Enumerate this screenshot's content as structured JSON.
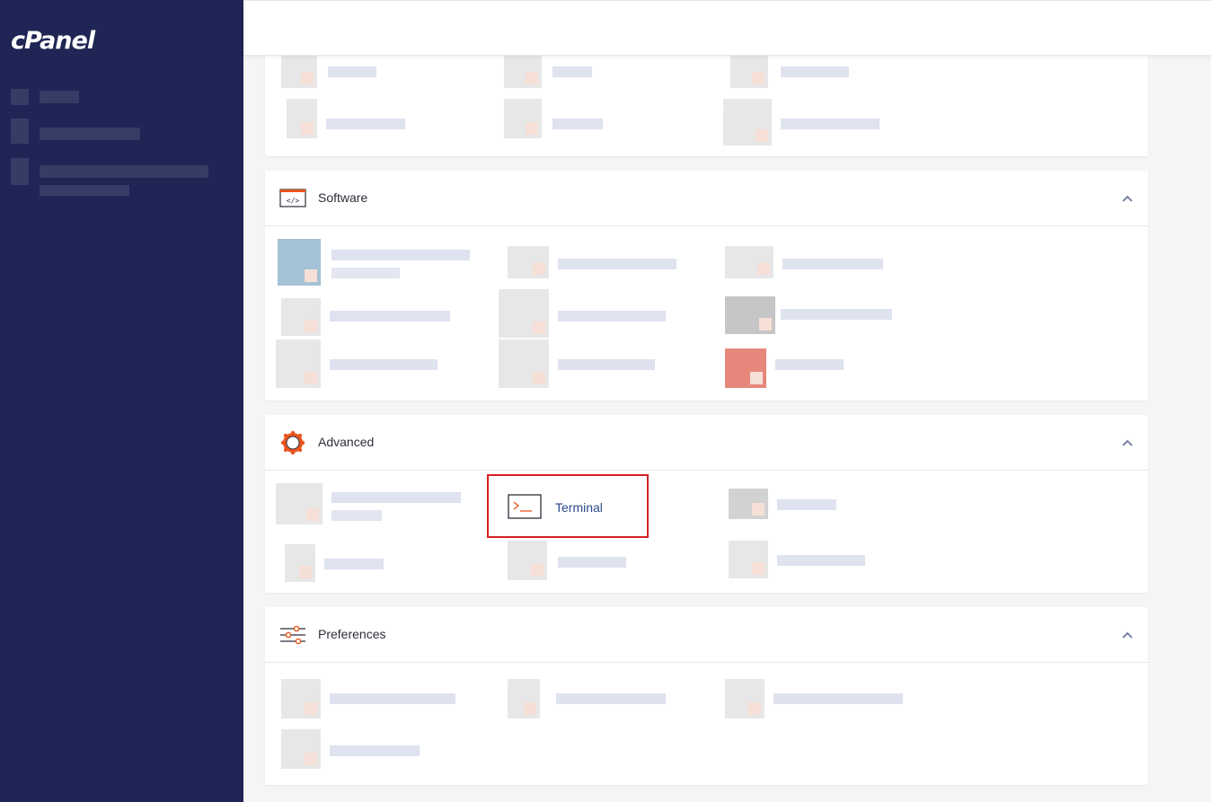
{
  "sidebar": {
    "logo": "cPanel"
  },
  "sections": {
    "software": {
      "title": "Software"
    },
    "advanced": {
      "title": "Advanced"
    },
    "preferences": {
      "title": "Preferences"
    }
  },
  "advanced_items": {
    "terminal": {
      "label": "Terminal"
    }
  },
  "colors": {
    "sidebar_bg": "#1f2554",
    "accent": "#e8541e",
    "highlight_border": "#d42020",
    "link_text": "#2b4a8a"
  },
  "icons": {
    "software": "code-window-icon",
    "advanced": "gear-icon",
    "preferences": "sliders-icon",
    "terminal": "terminal-icon",
    "collapse": "chevron-up-icon"
  }
}
